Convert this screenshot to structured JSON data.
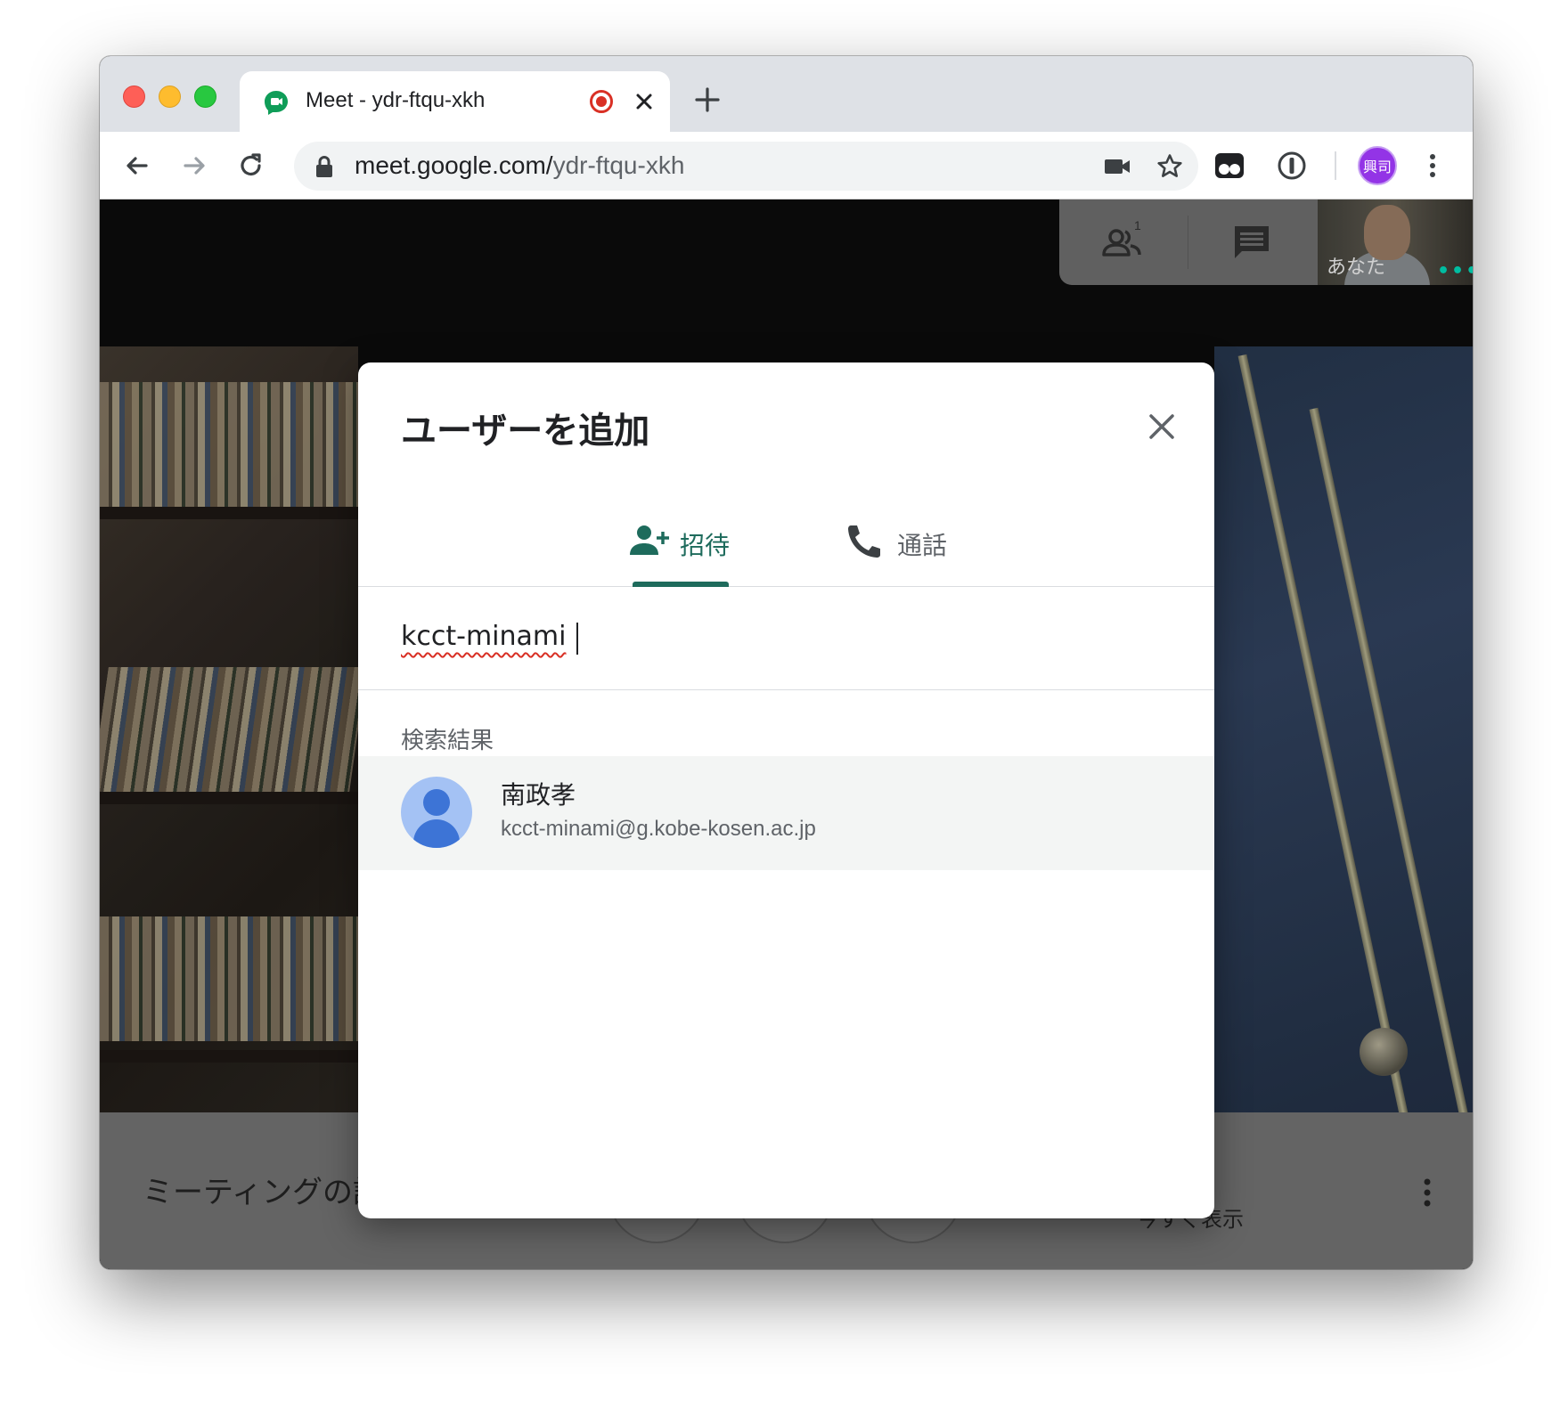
{
  "browser": {
    "tab_title": "Meet - ydr-ftqu-xkh",
    "url_host": "meet.google.com/",
    "url_path": "ydr-ftqu-xkh",
    "profile_initials": "興司"
  },
  "meet": {
    "self_label": "あなた",
    "participants_count": "1",
    "meeting_details": "ミーティングの詳細",
    "present_now": "今すぐ表示"
  },
  "dialog": {
    "title": "ユーザーを追加",
    "tabs": [
      {
        "label": "招待",
        "icon": "person-add-icon",
        "active": true
      },
      {
        "label": "通話",
        "icon": "phone-icon",
        "active": false
      }
    ],
    "search_value": "kcct-minami",
    "results_label": "検索結果",
    "results": [
      {
        "name": "南政孝",
        "email": "kcct-minami@g.kobe-kosen.ac.jp"
      }
    ]
  },
  "colors": {
    "accent": "#1e6b5c",
    "hangup": "#b3261e",
    "profile": "#9334e6"
  }
}
